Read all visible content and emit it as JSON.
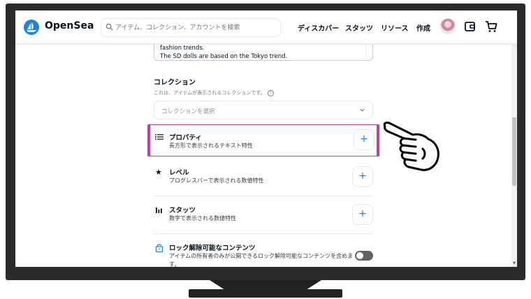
{
  "header": {
    "brand": "OpenSea",
    "search_placeholder": "アイテム、コレクション、アカウントを検索",
    "nav": [
      "ディスカバー",
      "スタッツ",
      "リソース",
      "作成"
    ],
    "icons": [
      "wallet-icon",
      "cart-icon"
    ]
  },
  "description": {
    "line1": "fashion trends.",
    "line2": "The SD dolls are based on the Tokyo trend."
  },
  "collection": {
    "title": "コレクション",
    "subtitle": "これは、アイテムが表示されるコレクションです。",
    "select_placeholder": "コレクションを選択"
  },
  "traits": [
    {
      "icon": "list-icon",
      "title": "プロパティ",
      "subtitle": "長方形で表示されるテキスト特性",
      "button": "+"
    },
    {
      "icon": "star-icon",
      "title": "レベル",
      "subtitle": "プログレスバーで表示される数値特性",
      "button": "+"
    },
    {
      "icon": "bar-chart-icon",
      "title": "スタッツ",
      "subtitle": "数字で表示される数値特性",
      "button": "+"
    }
  ],
  "unlockable": {
    "title": "ロック解除可能なコンテンツ",
    "subtitle_line1": "アイテムの所有者のみが公開できるロック解除可能なコンテンツを含めま",
    "subtitle_line2": "す。",
    "enabled": false
  },
  "colors": {
    "accent": "#2081e2",
    "highlight": "#c2409b",
    "frame": "#2b2b2b"
  }
}
